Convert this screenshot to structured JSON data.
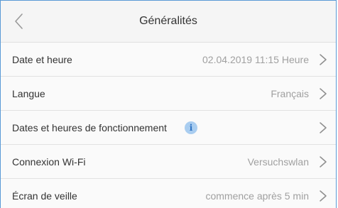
{
  "header": {
    "title": "Généralités",
    "back_icon": "chevron-left-icon"
  },
  "settings": {
    "rows": [
      {
        "label": "Date et heure",
        "value": "02.04.2019 11:15 Heure"
      },
      {
        "label": "Langue",
        "value": "Français"
      },
      {
        "label": "Dates et heures de fonctionnement",
        "value": "",
        "info_icon": "i"
      },
      {
        "label": "Connexion Wi-Fi",
        "value": "Versuchswlan"
      },
      {
        "label": "Écran de veille",
        "value": "commence après 5 min"
      }
    ]
  },
  "colors": {
    "frame_border": "#5a9ad6",
    "header_bg": "#f5f5f5",
    "label_text": "#333333",
    "value_text": "#a0a0a0",
    "info_badge": "#a9cdf0"
  }
}
